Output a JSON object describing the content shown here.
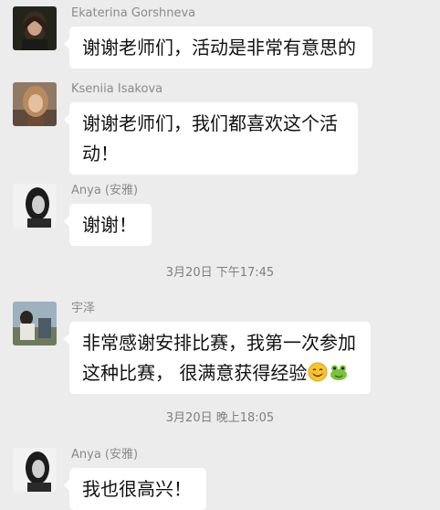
{
  "messages": [
    {
      "sender": "Ekaterina Gorshneva",
      "lines": [
        "谢谢老师们，活动是非常有意思的"
      ],
      "avatar_icon": "woman-portrait-dark-hair"
    },
    {
      "sender": "Kseniia Isakova",
      "lines": [
        "谢谢老师们，我们都喜欢这个活",
        "动！"
      ],
      "avatar_icon": "woman-portrait-light-hair"
    },
    {
      "sender": "Anya (安雅)",
      "lines": [
        "谢谢！"
      ],
      "avatar_icon": "woman-portrait-bw"
    },
    {
      "sender": "宇泽",
      "lines": [
        "非常感谢安排比赛，我第一次参加",
        "这种比赛， 很满意获得经验"
      ],
      "emojis": [
        "smiling-face-emoji",
        "frog-emoji"
      ],
      "avatar_icon": "man-outdoor-photo"
    },
    {
      "sender": "Anya (安雅)",
      "lines": [
        "我也很高兴！"
      ],
      "avatar_icon": "woman-portrait-bw"
    }
  ],
  "timestamps": [
    "3月20日 下午17:45",
    "3月20日 晚上18:05"
  ],
  "colors": {
    "background": "#ececec",
    "bubble": "#ffffff",
    "sender_text": "#8a8a8a",
    "timestamp_text": "#7f7f7f"
  }
}
